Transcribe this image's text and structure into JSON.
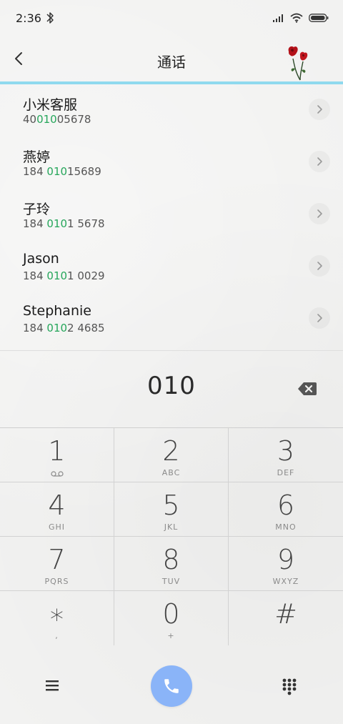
{
  "status_bar": {
    "time": "2:36"
  },
  "header": {
    "title": "通话"
  },
  "contacts": [
    {
      "name": "小米客服",
      "number_before": "40",
      "number_match": "010",
      "number_after": "05678"
    },
    {
      "name": "燕婷",
      "number_before": "184 ",
      "number_match": "010",
      "number_after": "15689"
    },
    {
      "name": "子玲",
      "number_before": "184 ",
      "number_match": "010",
      "number_after": "1 5678"
    },
    {
      "name": "Jason",
      "number_before": "184 ",
      "number_match": "010",
      "number_after": "1 0029"
    },
    {
      "name": "Stephanie",
      "number_before": "184 ",
      "number_match": "010",
      "number_after": "2 4685"
    }
  ],
  "dialer": {
    "input": "010"
  },
  "keypad": [
    {
      "digit": "1",
      "letters": ""
    },
    {
      "digit": "2",
      "letters": "ABC"
    },
    {
      "digit": "3",
      "letters": "DEF"
    },
    {
      "digit": "4",
      "letters": "GHI"
    },
    {
      "digit": "5",
      "letters": "JKL"
    },
    {
      "digit": "6",
      "letters": "MNO"
    },
    {
      "digit": "7",
      "letters": "PQRS"
    },
    {
      "digit": "8",
      "letters": "TUV"
    },
    {
      "digit": "9",
      "letters": "WXYZ"
    },
    {
      "digit": "*",
      "letters": ","
    },
    {
      "digit": "0",
      "letters": "+"
    },
    {
      "digit": "#",
      "letters": ""
    }
  ],
  "colors": {
    "accent_line": "#8fd9ee",
    "match_highlight": "#26a65b",
    "call_button": "#8ab4f8"
  },
  "icons": {
    "back": "back-arrow-icon",
    "voicemail": "voicemail-icon",
    "backspace": "backspace-icon",
    "menu": "menu-icon",
    "call": "phone-icon",
    "dialpad": "dialpad-icon"
  }
}
